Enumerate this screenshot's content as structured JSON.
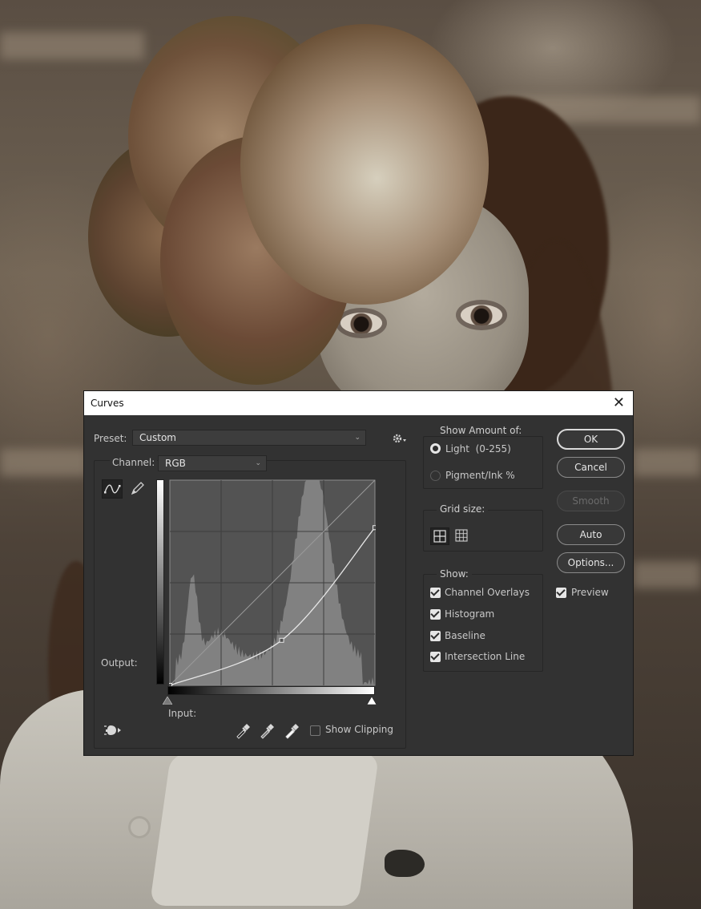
{
  "dialog": {
    "title": "Curves",
    "preset_label": "Preset:",
    "preset_value": "Custom",
    "channel_label": "Channel:",
    "channel_value": "RGB",
    "output_label": "Output:",
    "input_label": "Input:",
    "show_clipping_label": "Show Clipping",
    "show_clipping_checked": false
  },
  "show_amount": {
    "label": "Show Amount of:",
    "options": [
      {
        "label": "Light  (0-255)",
        "selected": true
      },
      {
        "label": "Pigment/Ink %",
        "selected": false
      }
    ]
  },
  "grid_size": {
    "label": "Grid size:"
  },
  "show": {
    "label": "Show:",
    "items": [
      {
        "label": "Channel Overlays",
        "checked": true
      },
      {
        "label": "Histogram",
        "checked": true
      },
      {
        "label": "Baseline",
        "checked": true
      },
      {
        "label": "Intersection Line",
        "checked": true
      }
    ]
  },
  "buttons": {
    "ok": "OK",
    "cancel": "Cancel",
    "smooth": "Smooth",
    "auto": "Auto",
    "options": "Options..."
  },
  "preview": {
    "label": "Preview",
    "checked": true
  },
  "curve": {
    "points": [
      [
        0,
        0
      ],
      [
        139,
        56
      ],
      [
        255,
        196
      ]
    ]
  },
  "colors": {
    "dialog_bg": "#323232",
    "graph_bg": "#535353",
    "histogram": "#8a8a8a",
    "curve": "#e6e6e6"
  }
}
